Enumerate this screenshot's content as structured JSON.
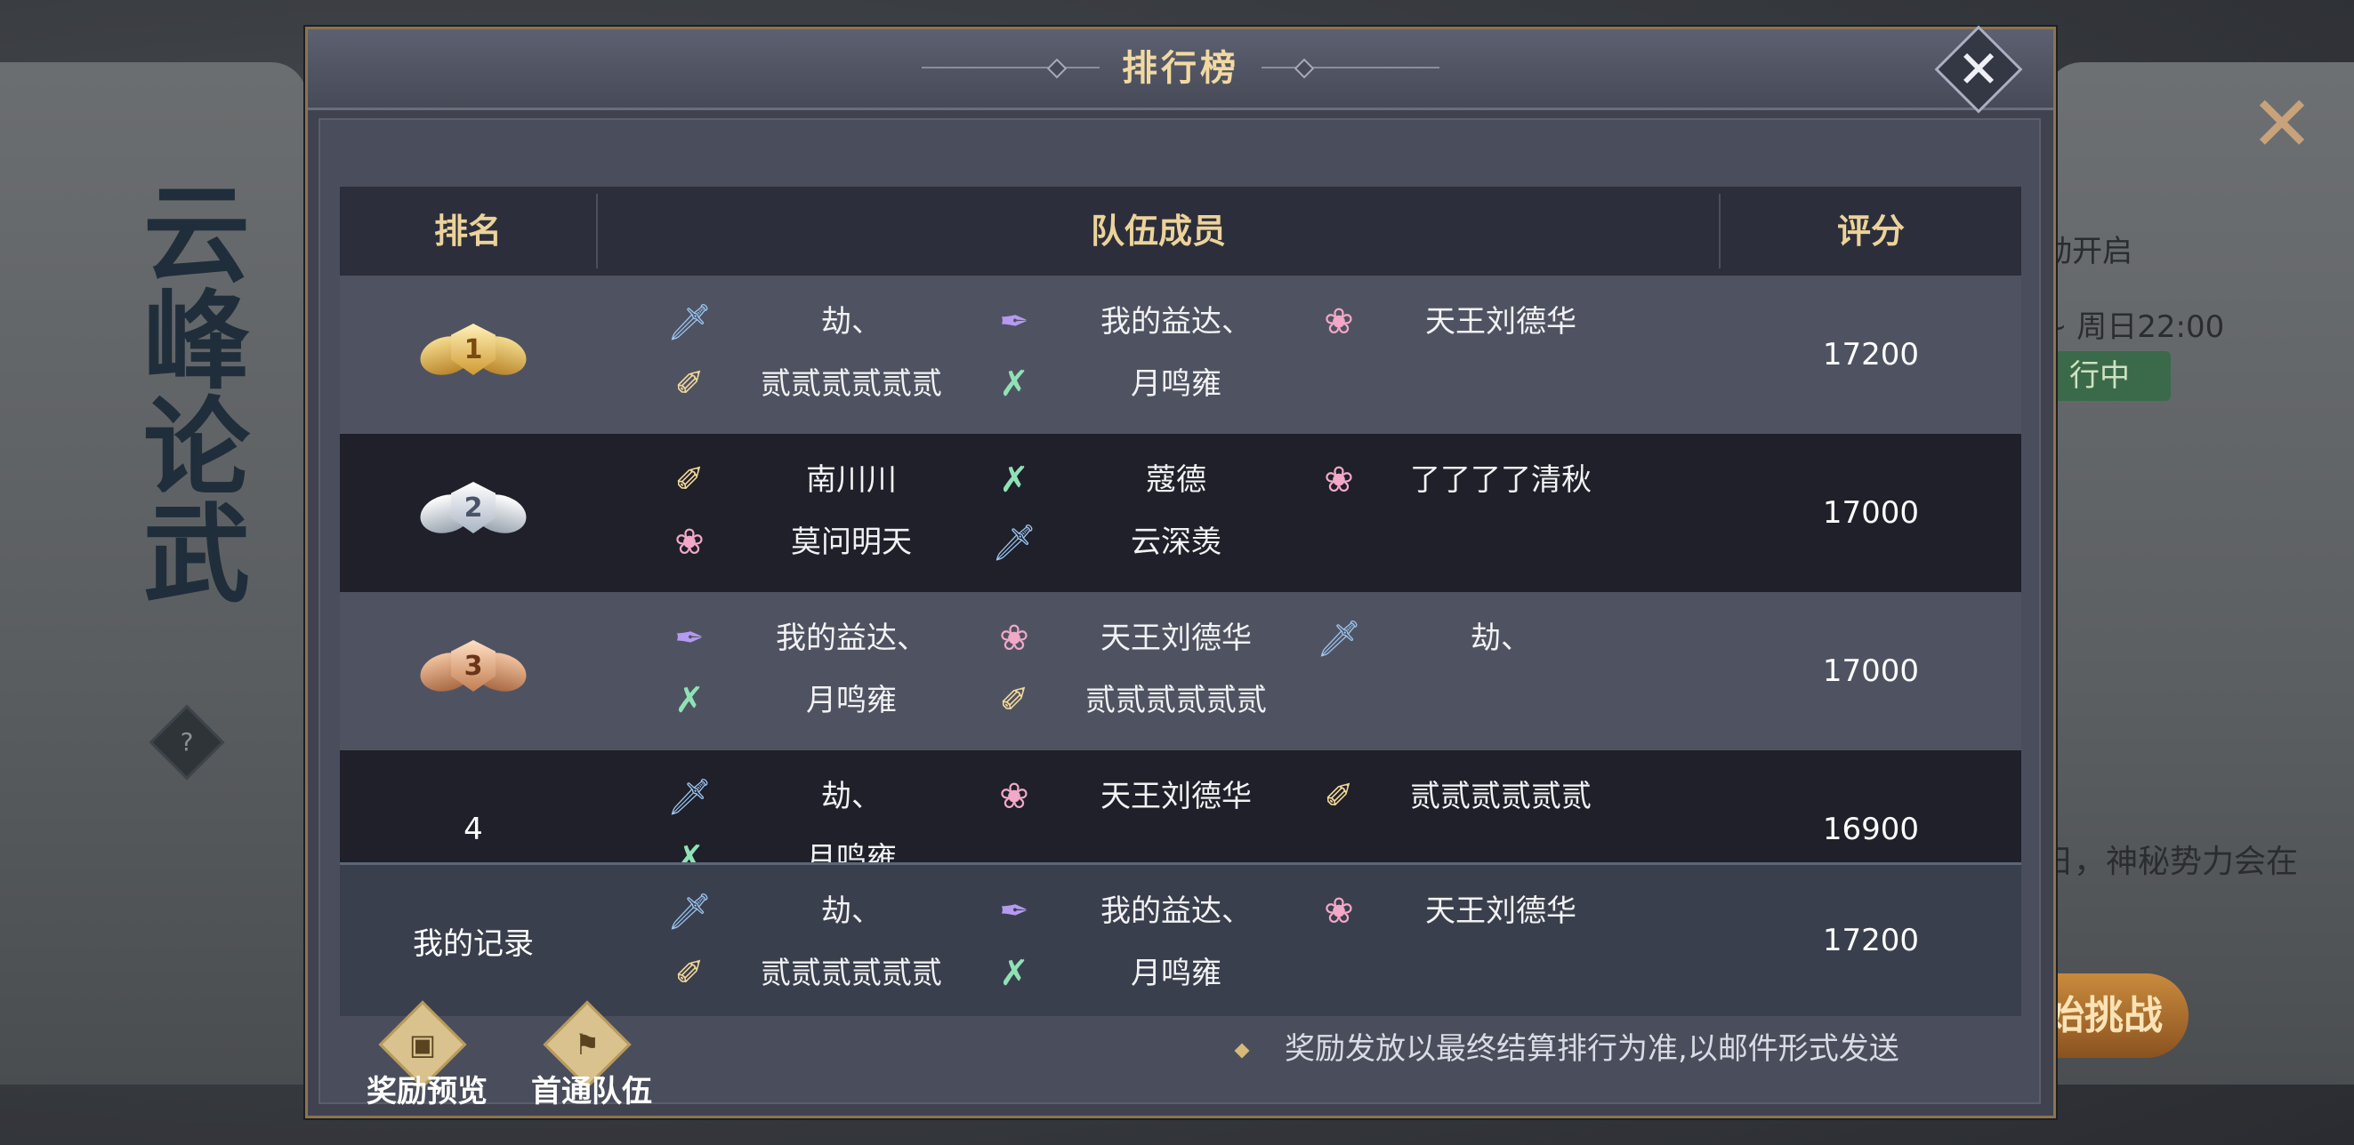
{
  "background": {
    "title": "云峰论武",
    "help_icon": "question-icon",
    "close_icon": "close-icon",
    "right_text_1": "动开启",
    "right_text_2": "~ 周日22:00",
    "status_badge": "行中",
    "right_text_3": "日，神秘势力会在",
    "challenge_button": "始挑战"
  },
  "modal": {
    "title": "排行榜",
    "close_icon": "close-icon"
  },
  "table": {
    "headers": {
      "rank": "排名",
      "members": "队伍成员",
      "score": "评分"
    },
    "rows": [
      {
        "rank": "1",
        "medal": "gold",
        "members": [
          {
            "icon": "sword",
            "name": "劫、"
          },
          {
            "icon": "feather",
            "name": "我的益达、"
          },
          {
            "icon": "fan",
            "name": "天王刘德华"
          },
          {
            "icon": "scroll",
            "name": "贰贰贰贰贰贰"
          },
          {
            "icon": "cross",
            "name": "月鸣雍"
          }
        ],
        "score": "17200"
      },
      {
        "rank": "2",
        "medal": "silver",
        "members": [
          {
            "icon": "scroll",
            "name": "南川川"
          },
          {
            "icon": "cross",
            "name": "蔻德"
          },
          {
            "icon": "fan",
            "name": "了了了了清秋"
          },
          {
            "icon": "fan",
            "name": "莫问明天"
          },
          {
            "icon": "sword",
            "name": "云深羡"
          }
        ],
        "score": "17000"
      },
      {
        "rank": "3",
        "medal": "bronze",
        "members": [
          {
            "icon": "feather",
            "name": "我的益达、"
          },
          {
            "icon": "fan",
            "name": "天王刘德华"
          },
          {
            "icon": "sword",
            "name": "劫、"
          },
          {
            "icon": "cross",
            "name": "月鸣雍"
          },
          {
            "icon": "scroll",
            "name": "贰贰贰贰贰贰"
          }
        ],
        "score": "17000"
      },
      {
        "rank": "4",
        "medal": "",
        "members": [
          {
            "icon": "sword",
            "name": "劫、"
          },
          {
            "icon": "fan",
            "name": "天王刘德华"
          },
          {
            "icon": "scroll",
            "name": "贰贰贰贰贰贰"
          },
          {
            "icon": "cross",
            "name": "月鸣雍"
          }
        ],
        "score": "16900"
      }
    ],
    "my_record": {
      "label": "我的记录",
      "members": [
        {
          "icon": "sword",
          "name": "劫、"
        },
        {
          "icon": "feather",
          "name": "我的益达、"
        },
        {
          "icon": "fan",
          "name": "天王刘德华"
        },
        {
          "icon": "scroll",
          "name": "贰贰贰贰贰贰"
        },
        {
          "icon": "cross",
          "name": "月鸣雍"
        }
      ],
      "score": "17200"
    }
  },
  "footer": {
    "reward_preview": "奖励预览",
    "first_clear_team": "首通队伍",
    "notice": "奖励发放以最终结算排行为准,以邮件形式发送"
  },
  "icons": {
    "sword": "🗡",
    "feather": "✒",
    "fan": "❀",
    "scroll": "✐",
    "cross": "✗"
  }
}
